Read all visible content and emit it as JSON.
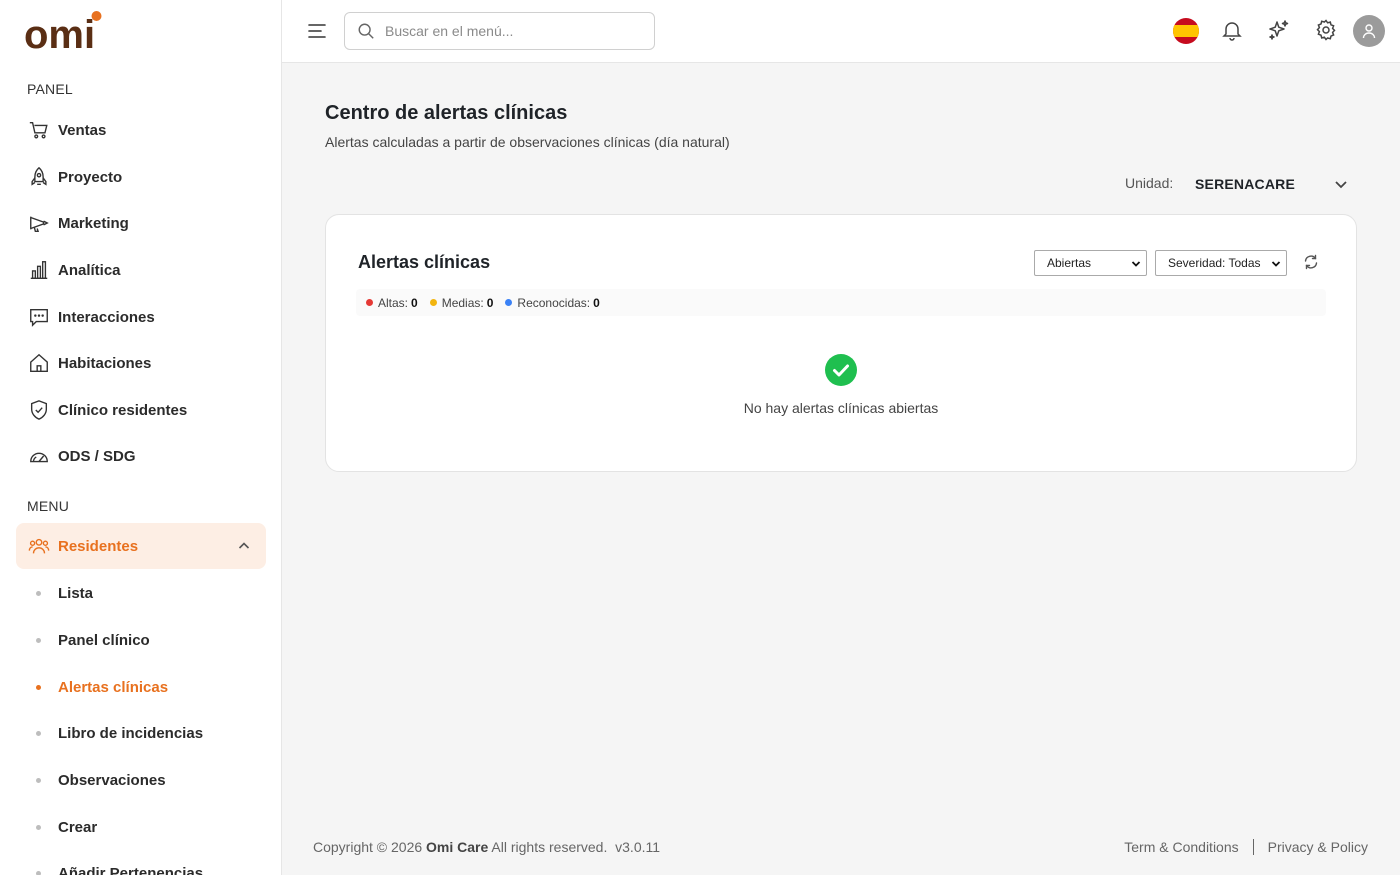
{
  "brand": {
    "logo_text": "omi",
    "accent": "#e8711f",
    "logo_color": "#5a2e14"
  },
  "sidebar": {
    "panel_label": "PANEL",
    "panel_items": [
      {
        "label": "Ventas",
        "icon": "cart-icon"
      },
      {
        "label": "Proyecto",
        "icon": "rocket-icon"
      },
      {
        "label": "Marketing",
        "icon": "megaphone-icon"
      },
      {
        "label": "Analítica",
        "icon": "bar-chart-icon"
      },
      {
        "label": "Interacciones",
        "icon": "chat-icon"
      },
      {
        "label": "Habitaciones",
        "icon": "home-icon"
      },
      {
        "label": "Clínico residentes",
        "icon": "shield-check-icon"
      },
      {
        "label": "ODS / SDG",
        "icon": "gauge-icon"
      }
    ],
    "menu_label": "MENU",
    "residents": {
      "label": "Residentes",
      "icon": "users-icon",
      "expanded": true
    },
    "sub_items": [
      {
        "label": "Lista",
        "active": false
      },
      {
        "label": "Panel clínico",
        "active": false
      },
      {
        "label": "Alertas clínicas",
        "active": true
      },
      {
        "label": "Libro de incidencias",
        "active": false
      },
      {
        "label": "Observaciones",
        "active": false
      },
      {
        "label": "Crear",
        "active": false
      },
      {
        "label": "Añadir Pertenencias",
        "active": false
      }
    ]
  },
  "header": {
    "search_placeholder": "Buscar en el menú...",
    "language": "es"
  },
  "main": {
    "title": "Centro de alertas clínicas",
    "subtitle": "Alertas calculadas a partir de observaciones clínicas (día natural)",
    "unit_label": "Unidad:",
    "unit_value": "SERENACARE",
    "card": {
      "title": "Alertas clínicas",
      "status_filter": "Abiertas",
      "severity_filter": "Severidad: Todas",
      "stats": [
        {
          "label": "Altas:",
          "value": "0",
          "color": "#e53935"
        },
        {
          "label": "Medias:",
          "value": "0",
          "color": "#f2b50f"
        },
        {
          "label": "Reconocidas:",
          "value": "0",
          "color": "#3b82f6"
        }
      ],
      "empty_message": "No hay alertas clínicas abiertas",
      "ok_color": "#1fbf4f"
    }
  },
  "footer": {
    "copyright_prefix": "Copyright © 2026",
    "company": "Omi Care",
    "rights": "All rights reserved.",
    "version": "v3.0.11",
    "terms": "Term & Conditions",
    "privacy": "Privacy & Policy"
  }
}
